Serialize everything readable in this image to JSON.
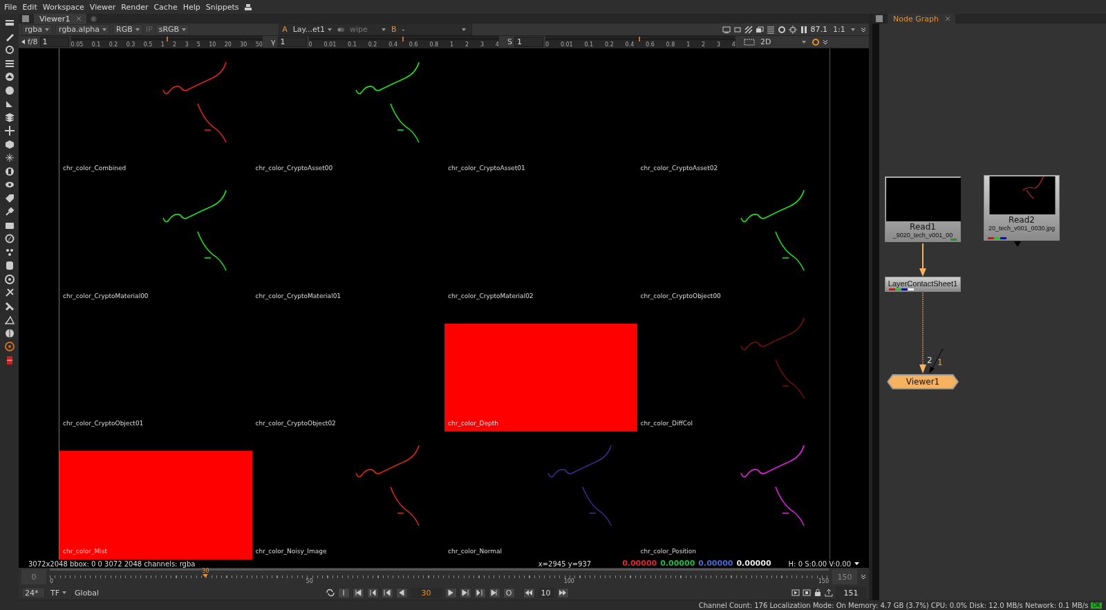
{
  "menu": [
    "File",
    "Edit",
    "Workspace",
    "Viewer",
    "Render",
    "Cache",
    "Help",
    "Snippets"
  ],
  "viewer": {
    "tabs": [
      {
        "label": "Viewer1",
        "selected": true
      }
    ],
    "controls": {
      "channels": "rgba",
      "alpha": "rgba.alpha",
      "display": "RGB",
      "ip": "IP",
      "lut": "sRGB",
      "input_a_label": "A",
      "input_a": "Lay...et1",
      "wipe": "wipe",
      "input_b_label": "B",
      "input_b": "-",
      "zoom": "87.1",
      "ratio": "1:1"
    },
    "rulers": [
      {
        "label": "f/8",
        "value": "1",
        "level": 0.5,
        "ticks": [
          "0.05",
          "0.1",
          "0.2",
          "0.3",
          "0.5",
          "1",
          "2",
          "3",
          "5",
          "10",
          "20",
          "30",
          "50"
        ]
      },
      {
        "label": "γ",
        "value": "1",
        "level": 0.49,
        "ticks": [
          "0",
          "0.01",
          "0.1",
          "0.2",
          "0.4",
          "0.6",
          "0.8",
          "1",
          "2",
          "3",
          "4"
        ]
      },
      {
        "label": "S",
        "value": "1",
        "level": 0.49,
        "ticks": [
          "0",
          "0.01",
          "0.1",
          "0.2",
          "0.4",
          "0.6",
          "0.8",
          "1",
          "2",
          "3",
          "4"
        ]
      }
    ],
    "view_mode": "2D",
    "contact_sheet": [
      {
        "label": "chr_color_Combined",
        "kind": "curve",
        "color": "#e02020"
      },
      {
        "label": "chr_color_CryptoAsset00",
        "kind": "curve",
        "color": "#20e020"
      },
      {
        "label": "chr_color_CryptoAsset01",
        "kind": "empty"
      },
      {
        "label": "chr_color_CryptoAsset02",
        "kind": "empty"
      },
      {
        "label": "chr_color_CryptoMaterial00",
        "kind": "curve",
        "color": "#20e020"
      },
      {
        "label": "chr_color_CryptoMaterial01",
        "kind": "empty"
      },
      {
        "label": "chr_color_CryptoMaterial02",
        "kind": "empty"
      },
      {
        "label": "chr_color_CryptoObject00",
        "kind": "curve",
        "color": "#20e020"
      },
      {
        "label": "chr_color_CryptoObject01",
        "kind": "empty"
      },
      {
        "label": "chr_color_CryptoObject02",
        "kind": "empty"
      },
      {
        "label": "chr_color_Depth",
        "kind": "fill",
        "color": "#ff0000"
      },
      {
        "label": "chr_color_DiffCol",
        "kind": "curve",
        "color": "#6a1208"
      },
      {
        "label": "chr_color_Mist",
        "kind": "fill",
        "color": "#ff0000"
      },
      {
        "label": "chr_color_Noisy_Image",
        "kind": "curve",
        "color": "#d02a1a"
      },
      {
        "label": "chr_color_Normal",
        "kind": "curve",
        "color": "#3a2a8a"
      },
      {
        "label": "chr_color_Position",
        "kind": "curve",
        "color": "#e020e0"
      }
    ],
    "info": {
      "format": "3072x2048  bbox: 0 0 3072 2048 channels: rgba",
      "coords": "x=2945 y=937",
      "values": [
        {
          "text": "0.00000",
          "color": "#e02a2a"
        },
        {
          "text": "0.00000",
          "color": "#20c040"
        },
        {
          "text": "0.00000",
          "color": "#4a6ad8"
        },
        {
          "text": "0.00000",
          "color": "#e8e8e8"
        }
      ],
      "hsv": "H:  0 S:0.00 V:0.00"
    },
    "timeline": {
      "start": "0",
      "end": "150",
      "ticks": [
        "0",
        "50",
        "100",
        "150"
      ],
      "current": "30",
      "level": 0.2
    },
    "playback": {
      "fps": "24*",
      "mode": "TF",
      "scope": "Global",
      "in_label": "I",
      "frame": "30",
      "out_label": "O",
      "step": "10",
      "end_frame": "151"
    }
  },
  "node_graph": {
    "tabs": [
      {
        "label": "Node Graph",
        "selected": true
      }
    ],
    "nodes": [
      {
        "kind": "read",
        "label": "Read1",
        "file": "_9020_tech_v001_00",
        "channels": [
          {
            "color": "#1a9a1a"
          }
        ]
      },
      {
        "kind": "read",
        "label": "Read2",
        "file": "20_tech_v001_0030.jpg",
        "channels": [
          {
            "color": "#ff0000"
          },
          {
            "color": "#00dd00"
          },
          {
            "color": "#0000ff"
          }
        ]
      },
      {
        "kind": "operator",
        "label": "LayerContactSheet1",
        "channels": [
          {
            "color": "#ff0000"
          },
          {
            "color": "#00dd00"
          },
          {
            "color": "#0000ff"
          },
          {
            "color": "#ffffff"
          }
        ]
      },
      {
        "kind": "viewer",
        "label": "Viewer1",
        "inputs": [
          "2",
          "1"
        ]
      }
    ]
  },
  "status": {
    "text": "Channel Count: 176 Localization Mode: On Memory: 4.7 GB (3.7%) CPU: 0.0% Disk: 12.0 MB/s Network: 0.1 MB/s",
    "badge": "OK"
  }
}
